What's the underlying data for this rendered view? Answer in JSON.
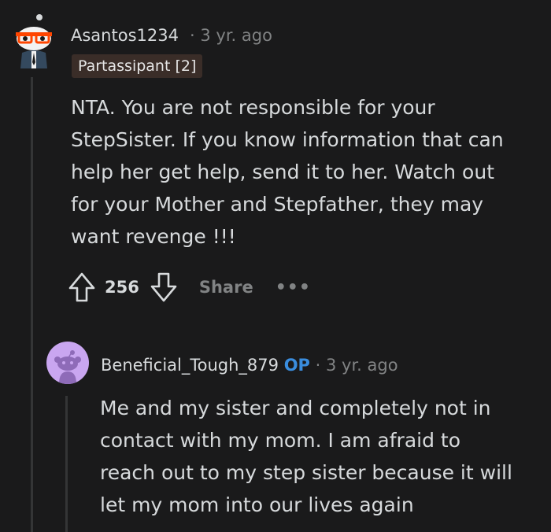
{
  "comment": {
    "username": "Asantos1234",
    "separator": "·",
    "age": "3 yr. ago",
    "flair": "Partassipant [2]",
    "body": "NTA. You are not responsible for your\nStepSister. If you know information that can\nhelp her get help, send it to her. Watch out\nfor your Mother and Stepfather, they may\nwant revenge !!!",
    "score": "256",
    "share_label": "Share",
    "more_label": "•••"
  },
  "reply": {
    "username": "Beneficial_Tough_879",
    "op_badge": "OP",
    "separator": "·",
    "age": "3 yr. ago",
    "body": "Me and my sister and completely not in\ncontact with my mom. I am afraid to\nreach out to my step sister because it will\nlet my mom into our lives again"
  },
  "icons": {
    "upvote": "upvote-icon",
    "downvote": "downvote-icon",
    "more": "more-options-icon"
  },
  "colors": {
    "background": "#1a1a1b",
    "text": "#d7dadc",
    "muted": "#818384",
    "op": "#3a8dde",
    "flair_bg": "#3a2d28",
    "reply_avatar_bg": "#c9a6f0"
  }
}
